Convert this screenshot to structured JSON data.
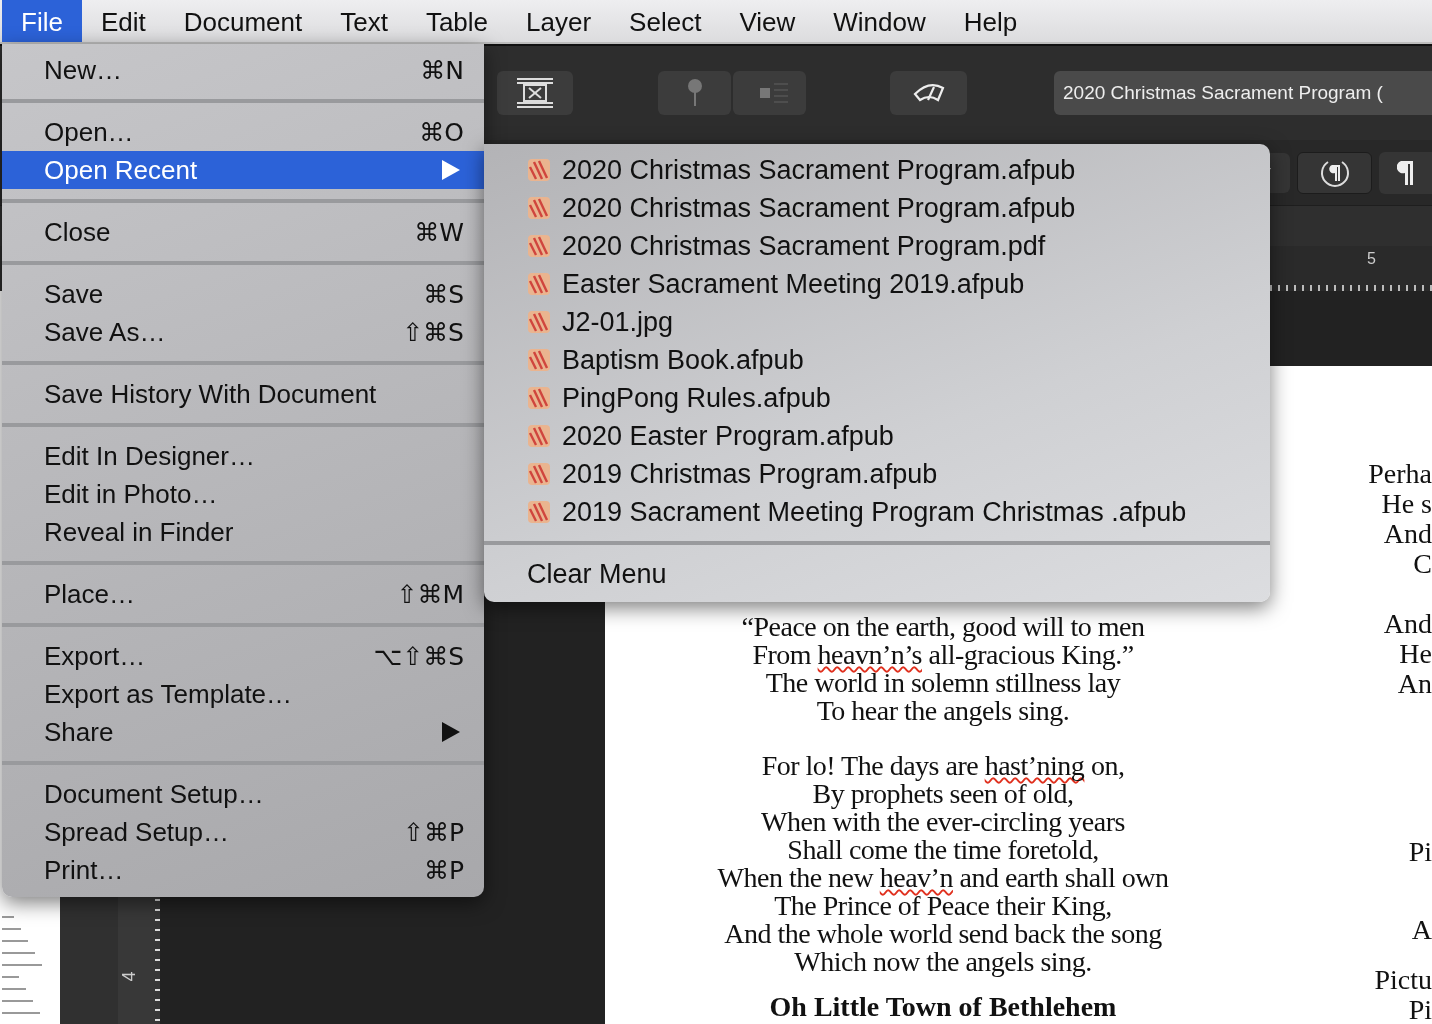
{
  "menu_bar": {
    "items": [
      {
        "label": "File",
        "selected": true
      },
      {
        "label": "Edit",
        "selected": false
      },
      {
        "label": "Document",
        "selected": false
      },
      {
        "label": "Text",
        "selected": false
      },
      {
        "label": "Table",
        "selected": false
      },
      {
        "label": "Layer",
        "selected": false
      },
      {
        "label": "Select",
        "selected": false
      },
      {
        "label": "View",
        "selected": false
      },
      {
        "label": "Window",
        "selected": false
      },
      {
        "label": "Help",
        "selected": false
      }
    ]
  },
  "toolbar": {
    "document_title": "2020 Christmas Sacrament Program ("
  },
  "rulers": {
    "horizontal_label": "5",
    "vertical_label": "4"
  },
  "file_menu": {
    "groups": [
      [
        {
          "label": "New…",
          "shortcut": "⌘N",
          "submenu": false,
          "selected": false
        }
      ],
      [
        {
          "label": "Open…",
          "shortcut": "⌘O",
          "submenu": false,
          "selected": false
        },
        {
          "label": "Open Recent",
          "submenu": true,
          "selected": true
        }
      ],
      [
        {
          "label": "Close",
          "shortcut": "⌘W",
          "submenu": false,
          "selected": false
        }
      ],
      [
        {
          "label": "Save",
          "shortcut": "⌘S",
          "submenu": false,
          "selected": false
        },
        {
          "label": "Save As…",
          "shortcut": "⇧⌘S",
          "submenu": false,
          "selected": false
        }
      ],
      [
        {
          "label": "Save History With Document",
          "submenu": false,
          "selected": false
        }
      ],
      [
        {
          "label": "Edit In Designer…",
          "submenu": false,
          "selected": false
        },
        {
          "label": "Edit in Photo…",
          "submenu": false,
          "selected": false
        },
        {
          "label": "Reveal in Finder",
          "submenu": false,
          "selected": false
        }
      ],
      [
        {
          "label": "Place…",
          "shortcut": "⇧⌘M",
          "submenu": false,
          "selected": false
        }
      ],
      [
        {
          "label": "Export…",
          "shortcut": "⌥⇧⌘S",
          "submenu": false,
          "selected": false
        },
        {
          "label": "Export as Template…",
          "submenu": false,
          "selected": false
        },
        {
          "label": "Share",
          "submenu": true,
          "selected": false
        }
      ],
      [
        {
          "label": "Document Setup…",
          "submenu": false,
          "selected": false
        },
        {
          "label": "Spread Setup…",
          "shortcut": "⇧⌘P",
          "submenu": false,
          "selected": false
        },
        {
          "label": "Print…",
          "shortcut": "⌘P",
          "submenu": false,
          "selected": false
        }
      ]
    ]
  },
  "recent_menu": {
    "items": [
      "2020 Christmas Sacrament Program.afpub",
      "2020 Christmas Sacrament Program.afpub",
      "2020 Christmas Sacrament Program.pdf",
      "Easter Sacrament Meeting 2019.afpub",
      "J2-01.jpg",
      "Baptism Book.afpub",
      "PingPong Rules.afpub",
      "2020 Easter Program.afpub",
      "2019 Christmas Program.afpub",
      "2019 Sacrament Meeting Program Christmas .afpub"
    ],
    "footer": "Clear Menu"
  },
  "document": {
    "stanzas": [
      [
        [
          {
            "text": "“Peace on the earth, good will to men",
            "misspelled": false
          }
        ],
        [
          {
            "text": "From ",
            "misspelled": false
          },
          {
            "text": "heavn’n’s",
            "misspelled": true
          },
          {
            "text": " all-gracious King.”",
            "misspelled": false
          }
        ],
        [
          {
            "text": "The world in solemn stillness lay",
            "misspelled": false
          }
        ],
        [
          {
            "text": "To hear the angels sing.",
            "misspelled": false
          }
        ]
      ],
      [
        [
          {
            "text": "For lo! The days are ",
            "misspelled": false
          },
          {
            "text": "hast’ning",
            "misspelled": true
          },
          {
            "text": " on,",
            "misspelled": false
          }
        ],
        [
          {
            "text": "By prophets seen of old,",
            "misspelled": false
          }
        ],
        [
          {
            "text": "When with the ever-circling years",
            "misspelled": false
          }
        ],
        [
          {
            "text": "Shall come the time foretold,",
            "misspelled": false
          }
        ],
        [
          {
            "text": "When the new ",
            "misspelled": false
          },
          {
            "text": "heav’n",
            "misspelled": true
          },
          {
            "text": " and earth shall own",
            "misspelled": false
          }
        ],
        [
          {
            "text": "The Prince of Peace their King,",
            "misspelled": false
          }
        ],
        [
          {
            "text": "And the whole world send back the song",
            "misspelled": false
          }
        ],
        [
          {
            "text": "Which now the angels sing.",
            "misspelled": false
          }
        ]
      ]
    ],
    "heading": "Oh Little Town of Bethlehem",
    "side_stanzas": [
      [
        "Perha",
        "He s",
        "And",
        "C"
      ],
      [
        "And",
        "He",
        "An"
      ],
      [
        "Pi"
      ],
      [
        "A"
      ],
      [
        "Pictu",
        "Pi"
      ]
    ]
  }
}
